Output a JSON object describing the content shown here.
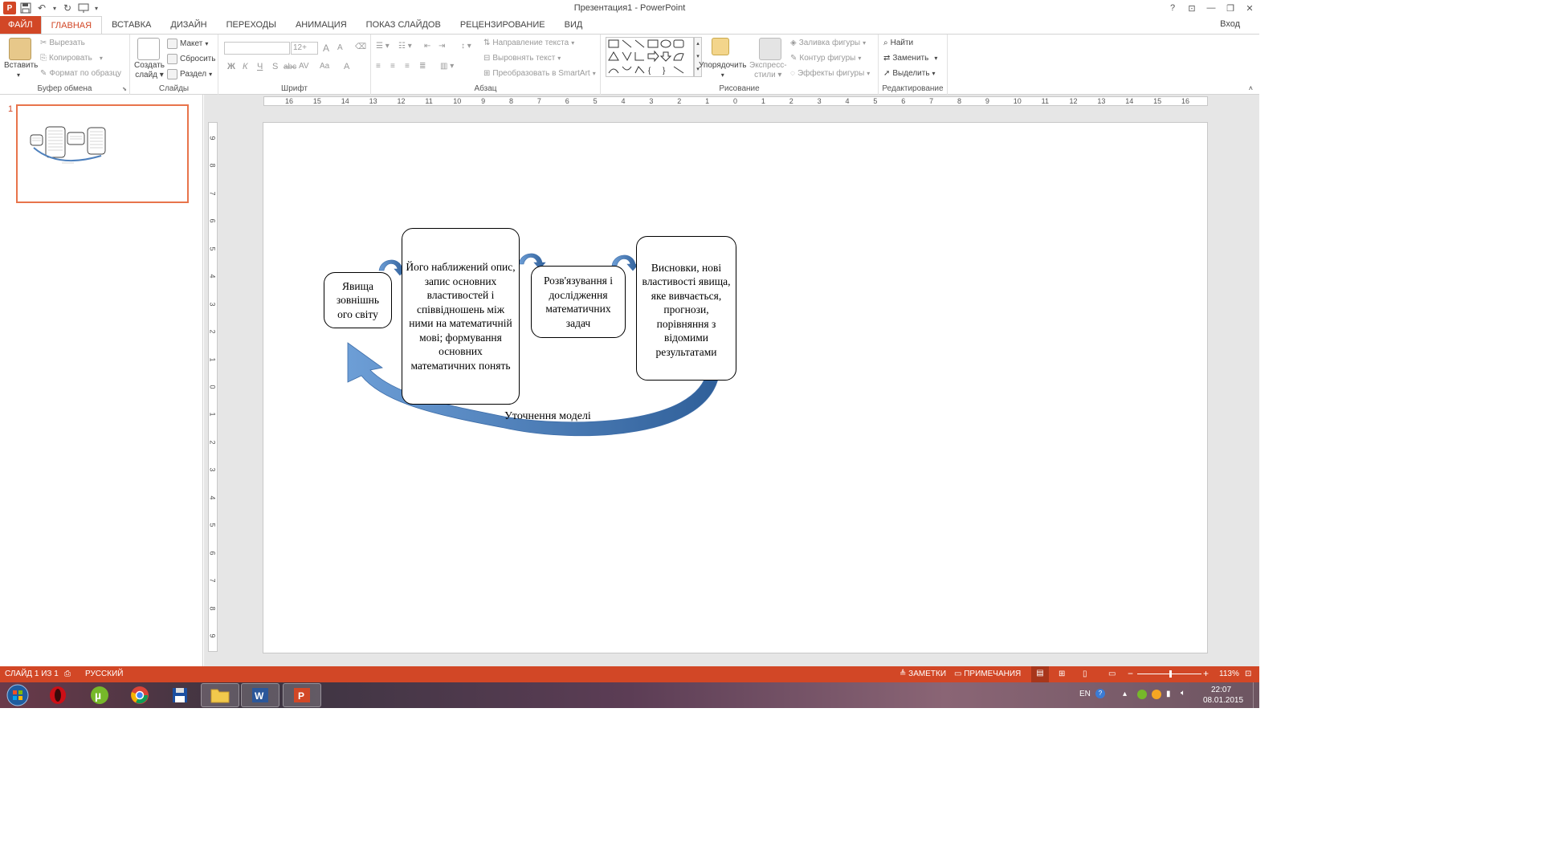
{
  "window": {
    "title": "Презентация1 - PowerPoint",
    "help": "?",
    "controls": [
      "⊡",
      "—",
      "❐",
      "✕"
    ]
  },
  "tabs": [
    "ФАЙЛ",
    "ГЛАВНАЯ",
    "ВСТАВКА",
    "ДИЗАЙН",
    "ПЕРЕХОДЫ",
    "АНИМАЦИЯ",
    "ПОКАЗ СЛАЙДОВ",
    "РЕЦЕНЗИРОВАНИЕ",
    "ВИД"
  ],
  "active_tab": "ГЛАВНАЯ",
  "signin": "Вход",
  "ribbon": {
    "clipboard": {
      "label": "Буфер обмена",
      "paste": "Вставить",
      "cut": "Вырезать",
      "copy": "Копировать",
      "format_painter": "Формат по образцу"
    },
    "slides": {
      "label": "Слайды",
      "new_slide_1": "Создать",
      "new_slide_2": "слайд",
      "layout": "Макет",
      "reset": "Сбросить",
      "section": "Раздел"
    },
    "font": {
      "label": "Шрифт",
      "size": "12+",
      "bold": "Ж",
      "italic": "К",
      "underline": "Ч",
      "strike": "S",
      "abc": "abc",
      "spacing": "AV",
      "case": "Aa",
      "grow": "A",
      "shrink": "A"
    },
    "paragraph": {
      "label": "Абзац",
      "text_direction": "Направление текста",
      "align_text": "Выровнять текст",
      "smartart": "Преобразовать в SmartArt"
    },
    "drawing": {
      "label": "Рисование",
      "arrange": "Упорядочить",
      "quick_styles_1": "Экспресс-",
      "quick_styles_2": "стили",
      "fill": "Заливка фигуры",
      "outline": "Контур фигуры",
      "effects": "Эффекты фигуры"
    },
    "editing": {
      "label": "Редактирование",
      "find": "Найти",
      "replace": "Заменить",
      "select": "Выделить"
    }
  },
  "thumbnails": [
    {
      "number": "1"
    }
  ],
  "ruler": {
    "h_ticks": [
      "16",
      "15",
      "14",
      "13",
      "12",
      "11",
      "10",
      "9",
      "8",
      "7",
      "6",
      "5",
      "4",
      "3",
      "2",
      "1",
      "0",
      "1",
      "2",
      "3",
      "4",
      "5",
      "6",
      "7",
      "8",
      "9",
      "10",
      "11",
      "12",
      "13",
      "14",
      "15",
      "16"
    ],
    "v_ticks": [
      "9",
      "8",
      "7",
      "6",
      "5",
      "4",
      "3",
      "2",
      "1",
      "0",
      "1",
      "2",
      "3",
      "4",
      "5",
      "6",
      "7",
      "8",
      "9"
    ]
  },
  "slide": {
    "boxes": [
      {
        "id": "phenomena",
        "text": "Явища зовнішнь ого світу"
      },
      {
        "id": "description",
        "text": "Його наближений опис, запис основних властивостей і співвідношень між ними на математичній мові; формування основних математичних понять"
      },
      {
        "id": "solving",
        "text": "Розв'язування і дослідження математичних задач"
      },
      {
        "id": "conclusions",
        "text": "Висновки, нові властивості явища, яке вивчається, прогнози, порівняння з відомими результатами"
      }
    ],
    "feedback_label": "Уточнення моделі",
    "arrow_color": "#4f81bd"
  },
  "status": {
    "slide": "СЛАЙД 1 ИЗ 1",
    "language": "РУССКИЙ",
    "notes": "ЗАМЕТКИ",
    "comments": "ПРИМЕЧАНИЯ",
    "zoom": "113%",
    "zoom_minus": "−",
    "zoom_plus": "+"
  },
  "taskbar": {
    "apps": [
      "start",
      "opera",
      "utorrent",
      "chrome",
      "save",
      "explorer",
      "word",
      "powerpoint"
    ],
    "lang": "EN",
    "time": "22:07",
    "date": "08.01.2015"
  },
  "colors": {
    "accent": "#d24726",
    "thumb_border": "#e8744b"
  }
}
